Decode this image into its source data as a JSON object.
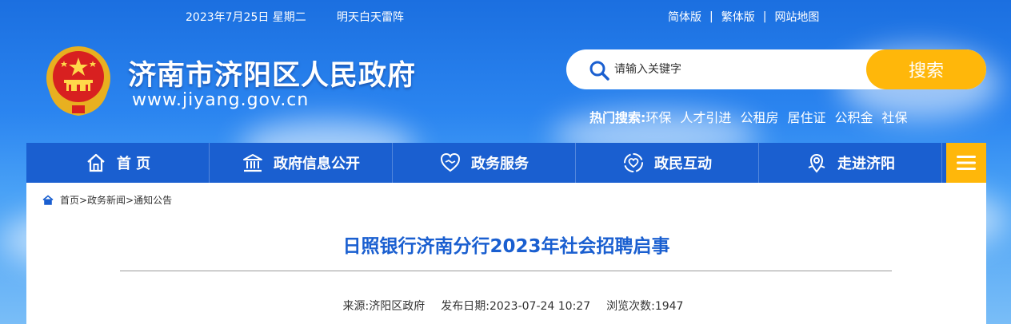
{
  "topbar": {
    "date": "2023年7月25日 星期二",
    "weather": "明天白天雷阵",
    "links": [
      "简体版",
      "繁体版",
      "网站地图"
    ]
  },
  "header": {
    "title": "济南市济阳区人民政府",
    "url": "www.jiyang.gov.cn"
  },
  "search": {
    "placeholder": "请输入关键字",
    "button": "搜索",
    "hot_label": "热门搜索:",
    "hot_items": [
      "环保",
      "人才引进",
      "公租房",
      "居住证",
      "公积金",
      "社保"
    ]
  },
  "nav": {
    "items": [
      {
        "label": "首 页",
        "icon": "home-icon"
      },
      {
        "label": "政府信息公开",
        "icon": "government-building-icon"
      },
      {
        "label": "政务服务",
        "icon": "handshake-heart-icon"
      },
      {
        "label": "政民互动",
        "icon": "people-heart-icon"
      },
      {
        "label": "走进济阳",
        "icon": "map-pin-icon"
      }
    ],
    "menu_icon": "hamburger-menu-icon"
  },
  "breadcrumb": {
    "icon": "home-icon",
    "text": "首页>政务新闻>通知公告"
  },
  "article": {
    "title": "日照银行济南分行2023年社会招聘启事",
    "source": "来源:济阳区政府",
    "publish_date": "发布日期:2023-07-24 10:27",
    "views": "浏览次数:1947"
  },
  "colors": {
    "nav_blue": "#1a5fd0",
    "accent_yellow": "#ffb70a",
    "title_blue": "#1a5fd0"
  }
}
